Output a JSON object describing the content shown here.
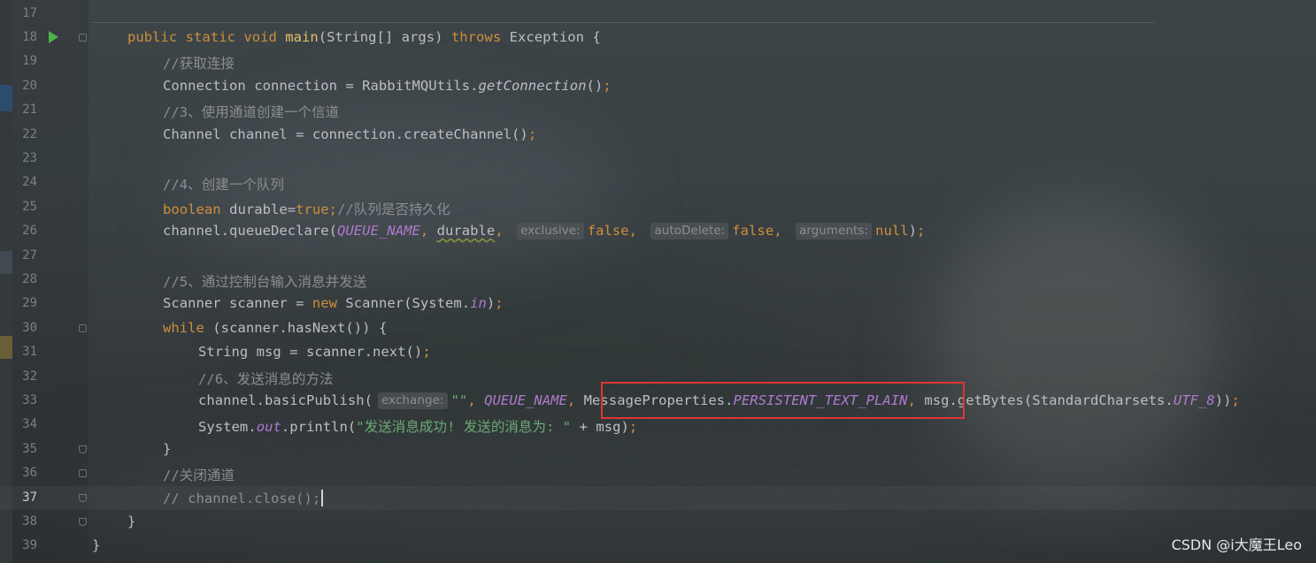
{
  "editor": {
    "lines": [
      {
        "n": "17",
        "segs": []
      },
      {
        "n": "18",
        "segs": [
          {
            "t": "public static void ",
            "c": "kw"
          },
          {
            "t": "main",
            "c": "fn"
          },
          {
            "t": "(String[] args) "
          },
          {
            "t": "throws",
            "c": "kw"
          },
          {
            "t": " Exception {"
          }
        ]
      },
      {
        "n": "19",
        "segs": [
          {
            "t": "//获取连接",
            "c": "cm"
          }
        ]
      },
      {
        "n": "20",
        "segs": [
          {
            "t": "Connection connection = RabbitMQUtils."
          },
          {
            "t": "getConnection",
            "c": "mt"
          },
          {
            "t": "()"
          },
          {
            "t": ";",
            "c": "kw"
          }
        ]
      },
      {
        "n": "21",
        "segs": [
          {
            "t": "//3、使用通道创建一个信道",
            "c": "cm"
          }
        ]
      },
      {
        "n": "22",
        "segs": [
          {
            "t": "Channel channel = connection.createChannel()"
          },
          {
            "t": ";",
            "c": "kw"
          }
        ]
      },
      {
        "n": "23",
        "segs": []
      },
      {
        "n": "24",
        "segs": [
          {
            "t": "//4、创建一个队列",
            "c": "cm"
          }
        ]
      },
      {
        "n": "25",
        "segs": [
          {
            "t": "boolean",
            "c": "kw"
          },
          {
            "t": " durable="
          },
          {
            "t": "true",
            "c": "kw"
          },
          {
            "t": ";",
            "c": "kw"
          },
          {
            "t": "//队列是否持久化",
            "c": "cm"
          }
        ]
      },
      {
        "n": "26",
        "segs": [
          {
            "t": "channel.queueDeclare("
          },
          {
            "t": "QUEUE_NAME",
            "c": "cs"
          },
          {
            "t": ", ",
            "c": "kw"
          },
          {
            "t": "durable",
            "c": "squig"
          },
          {
            "t": ", ",
            "c": "kw"
          },
          {
            "t": "exclusive:",
            "c": "hint"
          },
          {
            "t": "false",
            "c": "kw"
          },
          {
            "t": ", ",
            "c": "kw"
          },
          {
            "t": "autoDelete:",
            "c": "hint"
          },
          {
            "t": "false",
            "c": "kw"
          },
          {
            "t": ", ",
            "c": "kw"
          },
          {
            "t": "arguments:",
            "c": "hint"
          },
          {
            "t": "null",
            "c": "kw"
          },
          {
            "t": ")"
          },
          {
            "t": ";",
            "c": "kw"
          }
        ]
      },
      {
        "n": "27",
        "segs": []
      },
      {
        "n": "28",
        "segs": [
          {
            "t": "//5、通过控制台输入消息并发送",
            "c": "cm"
          }
        ]
      },
      {
        "n": "29",
        "segs": [
          {
            "t": "Scanner scanner = "
          },
          {
            "t": "new",
            "c": "kw"
          },
          {
            "t": " Scanner(System."
          },
          {
            "t": "in",
            "c": "cs"
          },
          {
            "t": ")"
          },
          {
            "t": ";",
            "c": "kw"
          }
        ]
      },
      {
        "n": "30",
        "segs": [
          {
            "t": "while",
            "c": "kw"
          },
          {
            "t": " (scanner.hasNext()) {"
          }
        ]
      },
      {
        "n": "31",
        "segs": [
          {
            "t": "String msg = scanner.next()"
          },
          {
            "t": ";",
            "c": "kw"
          }
        ]
      },
      {
        "n": "32",
        "segs": [
          {
            "t": "//6、发送消息的方法",
            "c": "cm"
          }
        ]
      },
      {
        "n": "33",
        "segs": [
          {
            "t": "channel.basicPublish("
          },
          {
            "t": "exchange:",
            "c": "hint"
          },
          {
            "t": "\"\"",
            "c": "st"
          },
          {
            "t": ", ",
            "c": "kw"
          },
          {
            "t": "QUEUE_NAME",
            "c": "cs"
          },
          {
            "t": ", ",
            "c": "kw"
          },
          {
            "t": "MessageProperties."
          },
          {
            "t": "PERSISTENT_TEXT_PLAIN",
            "c": "cs"
          },
          {
            "t": ", ",
            "c": "kw"
          },
          {
            "t": "msg.getBytes(StandardCharsets."
          },
          {
            "t": "UTF_8",
            "c": "cs"
          },
          {
            "t": "))"
          },
          {
            "t": ";",
            "c": "kw"
          }
        ]
      },
      {
        "n": "34",
        "segs": [
          {
            "t": "System."
          },
          {
            "t": "out",
            "c": "cs"
          },
          {
            "t": ".println("
          },
          {
            "t": "\"发送消息成功! 发送的消息为: \"",
            "c": "st"
          },
          {
            "t": " + msg)"
          },
          {
            "t": ";",
            "c": "kw"
          }
        ]
      },
      {
        "n": "35",
        "segs": [
          {
            "t": "}"
          }
        ]
      },
      {
        "n": "36",
        "segs": [
          {
            "t": "//关闭通道",
            "c": "cm"
          }
        ]
      },
      {
        "n": "37",
        "segs": [
          {
            "t": "// channel.close();",
            "c": "cm"
          },
          {
            "t": "",
            "c": "caret"
          }
        ]
      },
      {
        "n": "38",
        "segs": [
          {
            "t": "}"
          }
        ]
      },
      {
        "n": "39",
        "segs": [
          {
            "t": "}"
          }
        ]
      }
    ]
  },
  "watermark": "CSDN @i大魔王Leo",
  "colors": {
    "keyword": "#cf8e3a",
    "function": "#e8bf6a",
    "comment": "#8a8d91",
    "string": "#6aab73",
    "constant": "#b07ad0",
    "highlight_box": "#e03535",
    "run_icon": "#4fb24a"
  }
}
